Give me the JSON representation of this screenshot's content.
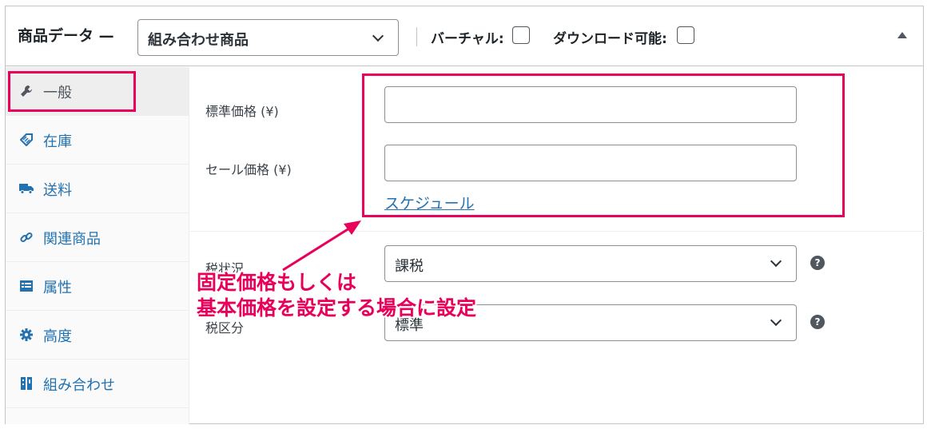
{
  "header": {
    "title": "商品データ —",
    "product_type": "組み合わせ商品",
    "virtual_label": "バーチャル:",
    "downloadable_label": "ダウンロード可能:"
  },
  "tabs": [
    {
      "label": "一般",
      "icon": "wrench-icon",
      "active": true
    },
    {
      "label": "在庫",
      "icon": "tag-icon",
      "active": false
    },
    {
      "label": "送料",
      "icon": "truck-icon",
      "active": false
    },
    {
      "label": "関連商品",
      "icon": "link-icon",
      "active": false
    },
    {
      "label": "属性",
      "icon": "list-icon",
      "active": false
    },
    {
      "label": "高度",
      "icon": "gear-icon",
      "active": false
    },
    {
      "label": "組み合わせ",
      "icon": "grid-icon",
      "active": false
    }
  ],
  "general": {
    "regular_price_label": "標準価格 (¥)",
    "regular_price_value": "",
    "sale_price_label": "セール価格 (¥)",
    "sale_price_value": "",
    "schedule_link": "スケジュール",
    "tax_status_label": "税状況",
    "tax_status_value": "課税",
    "tax_class_label": "税区分",
    "tax_class_value": "標準"
  },
  "annotation": {
    "line1": "固定価格もしくは",
    "line2": "基本価格を設定する場合に設定"
  },
  "colors": {
    "highlight": "#e8005a",
    "link": "#2271b1"
  }
}
